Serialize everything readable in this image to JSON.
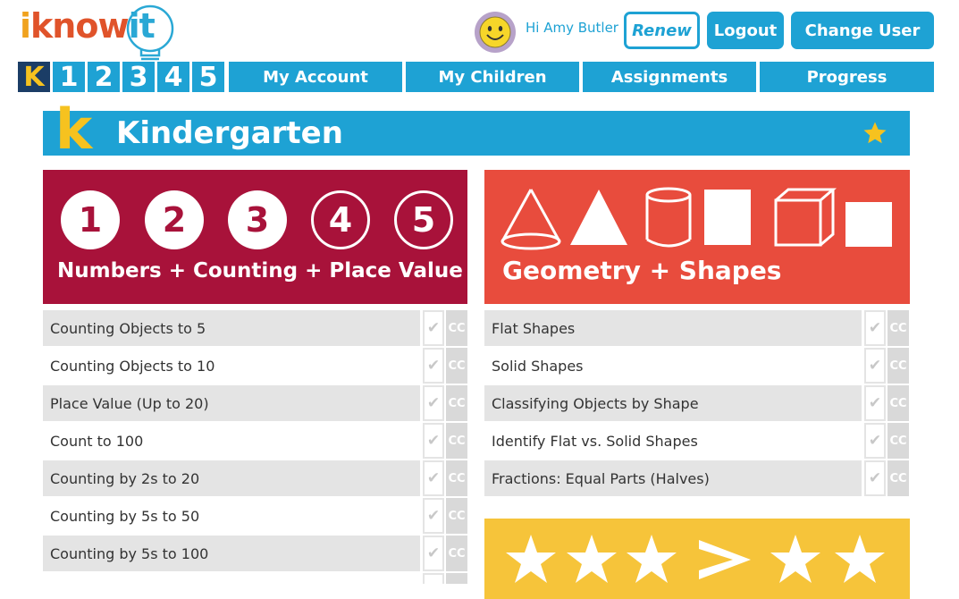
{
  "logo": {
    "part1": "i",
    "part2": "know",
    "part3": "it"
  },
  "header": {
    "greeting": "Hi Amy Butler",
    "renew_label": "Renew",
    "logout_label": "Logout",
    "change_user_label": "Change User"
  },
  "grades": [
    "K",
    "1",
    "2",
    "3",
    "4",
    "5"
  ],
  "nav": {
    "tabs": [
      "My Account",
      "My Children",
      "Assignments",
      "Progress"
    ]
  },
  "banner": {
    "letter": "k",
    "title": "Kindergarten"
  },
  "numbers_card": {
    "title": "Numbers + Counting + Place Value",
    "circles": [
      "1",
      "2",
      "3",
      "4",
      "5"
    ],
    "skills": [
      "Counting Objects to 5",
      "Counting Objects to 10",
      "Place Value (Up to 20)",
      "Count to 100",
      "Counting by 2s to 20",
      "Counting by 5s to 50",
      "Counting by 5s to 100"
    ]
  },
  "geometry_card": {
    "title": "Geometry + Shapes",
    "skills": [
      "Flat Shapes",
      "Solid Shapes",
      "Classifying Objects by Shape",
      "Identify Flat vs. Solid Shapes",
      "Fractions: Equal Parts (Halves)"
    ]
  },
  "common_core_label": "CC",
  "check_glyph": "✔",
  "colors": {
    "accent_blue": "#1ea2d4",
    "numbers_crimson": "#a8123a",
    "geometry_red": "#e84c3d",
    "banner_yellow": "#f6c21f",
    "grade_active_bg": "#1b3d66"
  }
}
